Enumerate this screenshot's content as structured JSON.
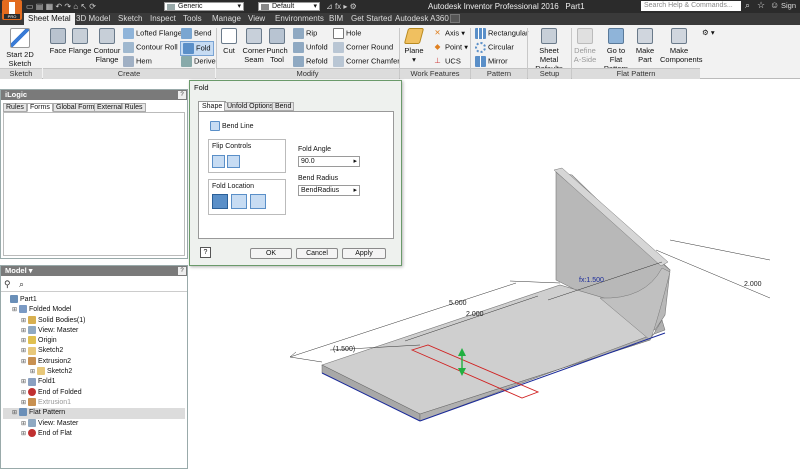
{
  "titlebar": {
    "app_title": "Autodesk Inventor Professional 2016",
    "document": "Part1",
    "search_placeholder": "Search Help & Commands...",
    "material": "Generic",
    "appearance": "Default",
    "sign_in": "Sign"
  },
  "tabs": [
    "Sheet Metal",
    "3D Model",
    "Sketch",
    "Inspect",
    "Tools",
    "Manage",
    "View",
    "Environments",
    "BIM",
    "Get Started",
    "Autodesk A360"
  ],
  "ribbon": {
    "sketch": {
      "start_sketch": "Start 2D Sketch",
      "panel_label": "Sketch"
    },
    "create": {
      "face": "Face",
      "flange": "Flange",
      "contour_flange": "Contour Flange",
      "lofted_flange": "Lofted Flange",
      "contour_roll": "Contour Roll",
      "hem": "Hem",
      "bend": "Bend",
      "fold": "Fold",
      "derive": "Derive",
      "panel_label": "Create"
    },
    "modify": {
      "cut": "Cut",
      "corner_seam": "Corner Seam",
      "punch_tool": "Punch Tool",
      "rip": "Rip",
      "unfold": "Unfold",
      "refold": "Refold",
      "hole": "Hole",
      "corner_round": "Corner Round",
      "corner_chamfer": "Corner Chamfer",
      "panel_label": "Modify"
    },
    "work_features": {
      "plane": "Plane",
      "axis": "Axis",
      "point": "Point",
      "ucs": "UCS",
      "panel_label": "Work Features"
    },
    "pattern": {
      "rectangular": "Rectangular",
      "circular": "Circular",
      "mirror": "Mirror",
      "panel_label": "Pattern"
    },
    "setup": {
      "sheet_metal_defaults": "Sheet Metal Defaults",
      "panel_label": "Setup"
    },
    "flat_pattern": {
      "define_aside": "Define A-Side",
      "go_to_flat": "Go to Flat Pattern",
      "make_part": "Make Part",
      "make_components": "Make Components",
      "panel_label": "Flat Pattern"
    }
  },
  "ilogic": {
    "title": "iLogic",
    "tabs": [
      "Rules",
      "Forms",
      "Global Forms",
      "External Rules"
    ]
  },
  "model": {
    "title": "Model",
    "tree": [
      {
        "label": "Part1",
        "level": 0,
        "icon": "part-icon"
      },
      {
        "label": "Folded Model",
        "level": 1,
        "icon": "folded-model-icon"
      },
      {
        "label": "Solid Bodies(1)",
        "level": 2,
        "icon": "solid-bodies-icon"
      },
      {
        "label": "View: Master",
        "level": 2,
        "icon": "view-icon"
      },
      {
        "label": "Origin",
        "level": 2,
        "icon": "origin-icon"
      },
      {
        "label": "Sketch2",
        "level": 2,
        "icon": "sketch-icon"
      },
      {
        "label": "Extrusion2",
        "level": 2,
        "icon": "extrusion-icon"
      },
      {
        "label": "Sketch2",
        "level": 3,
        "icon": "sketch-icon"
      },
      {
        "label": "Fold1",
        "level": 2,
        "icon": "fold-icon"
      },
      {
        "label": "End of Folded",
        "level": 2,
        "icon": "end-of-part-icon"
      },
      {
        "label": "Extrusion1",
        "level": 2,
        "icon": "extrusion-icon"
      },
      {
        "label": "Flat Pattern",
        "level": 1,
        "icon": "flat-pattern-icon"
      },
      {
        "label": "View: Master",
        "level": 2,
        "icon": "view-icon"
      },
      {
        "label": "End of Flat",
        "level": 2,
        "icon": "end-of-part-icon"
      }
    ]
  },
  "fold_dialog": {
    "title": "Fold",
    "tabs": [
      "Shape",
      "Unfold Options",
      "Bend"
    ],
    "bend_line": "Bend Line",
    "flip_controls": "Flip Controls",
    "fold_location": "Fold Location",
    "fold_angle_label": "Fold Angle",
    "fold_angle_value": "90.0",
    "bend_radius_label": "Bend Radius",
    "bend_radius_value": "BendRadius",
    "ok": "OK",
    "cancel": "Cancel",
    "apply": "Apply",
    "help": "?"
  },
  "viewport": {
    "dim_5000": "5.000",
    "dim_2000_a": "2.000",
    "dim_1500": "(1.500)",
    "dim_fx": "fx:1.500",
    "dim_2000_b": "2.000"
  }
}
